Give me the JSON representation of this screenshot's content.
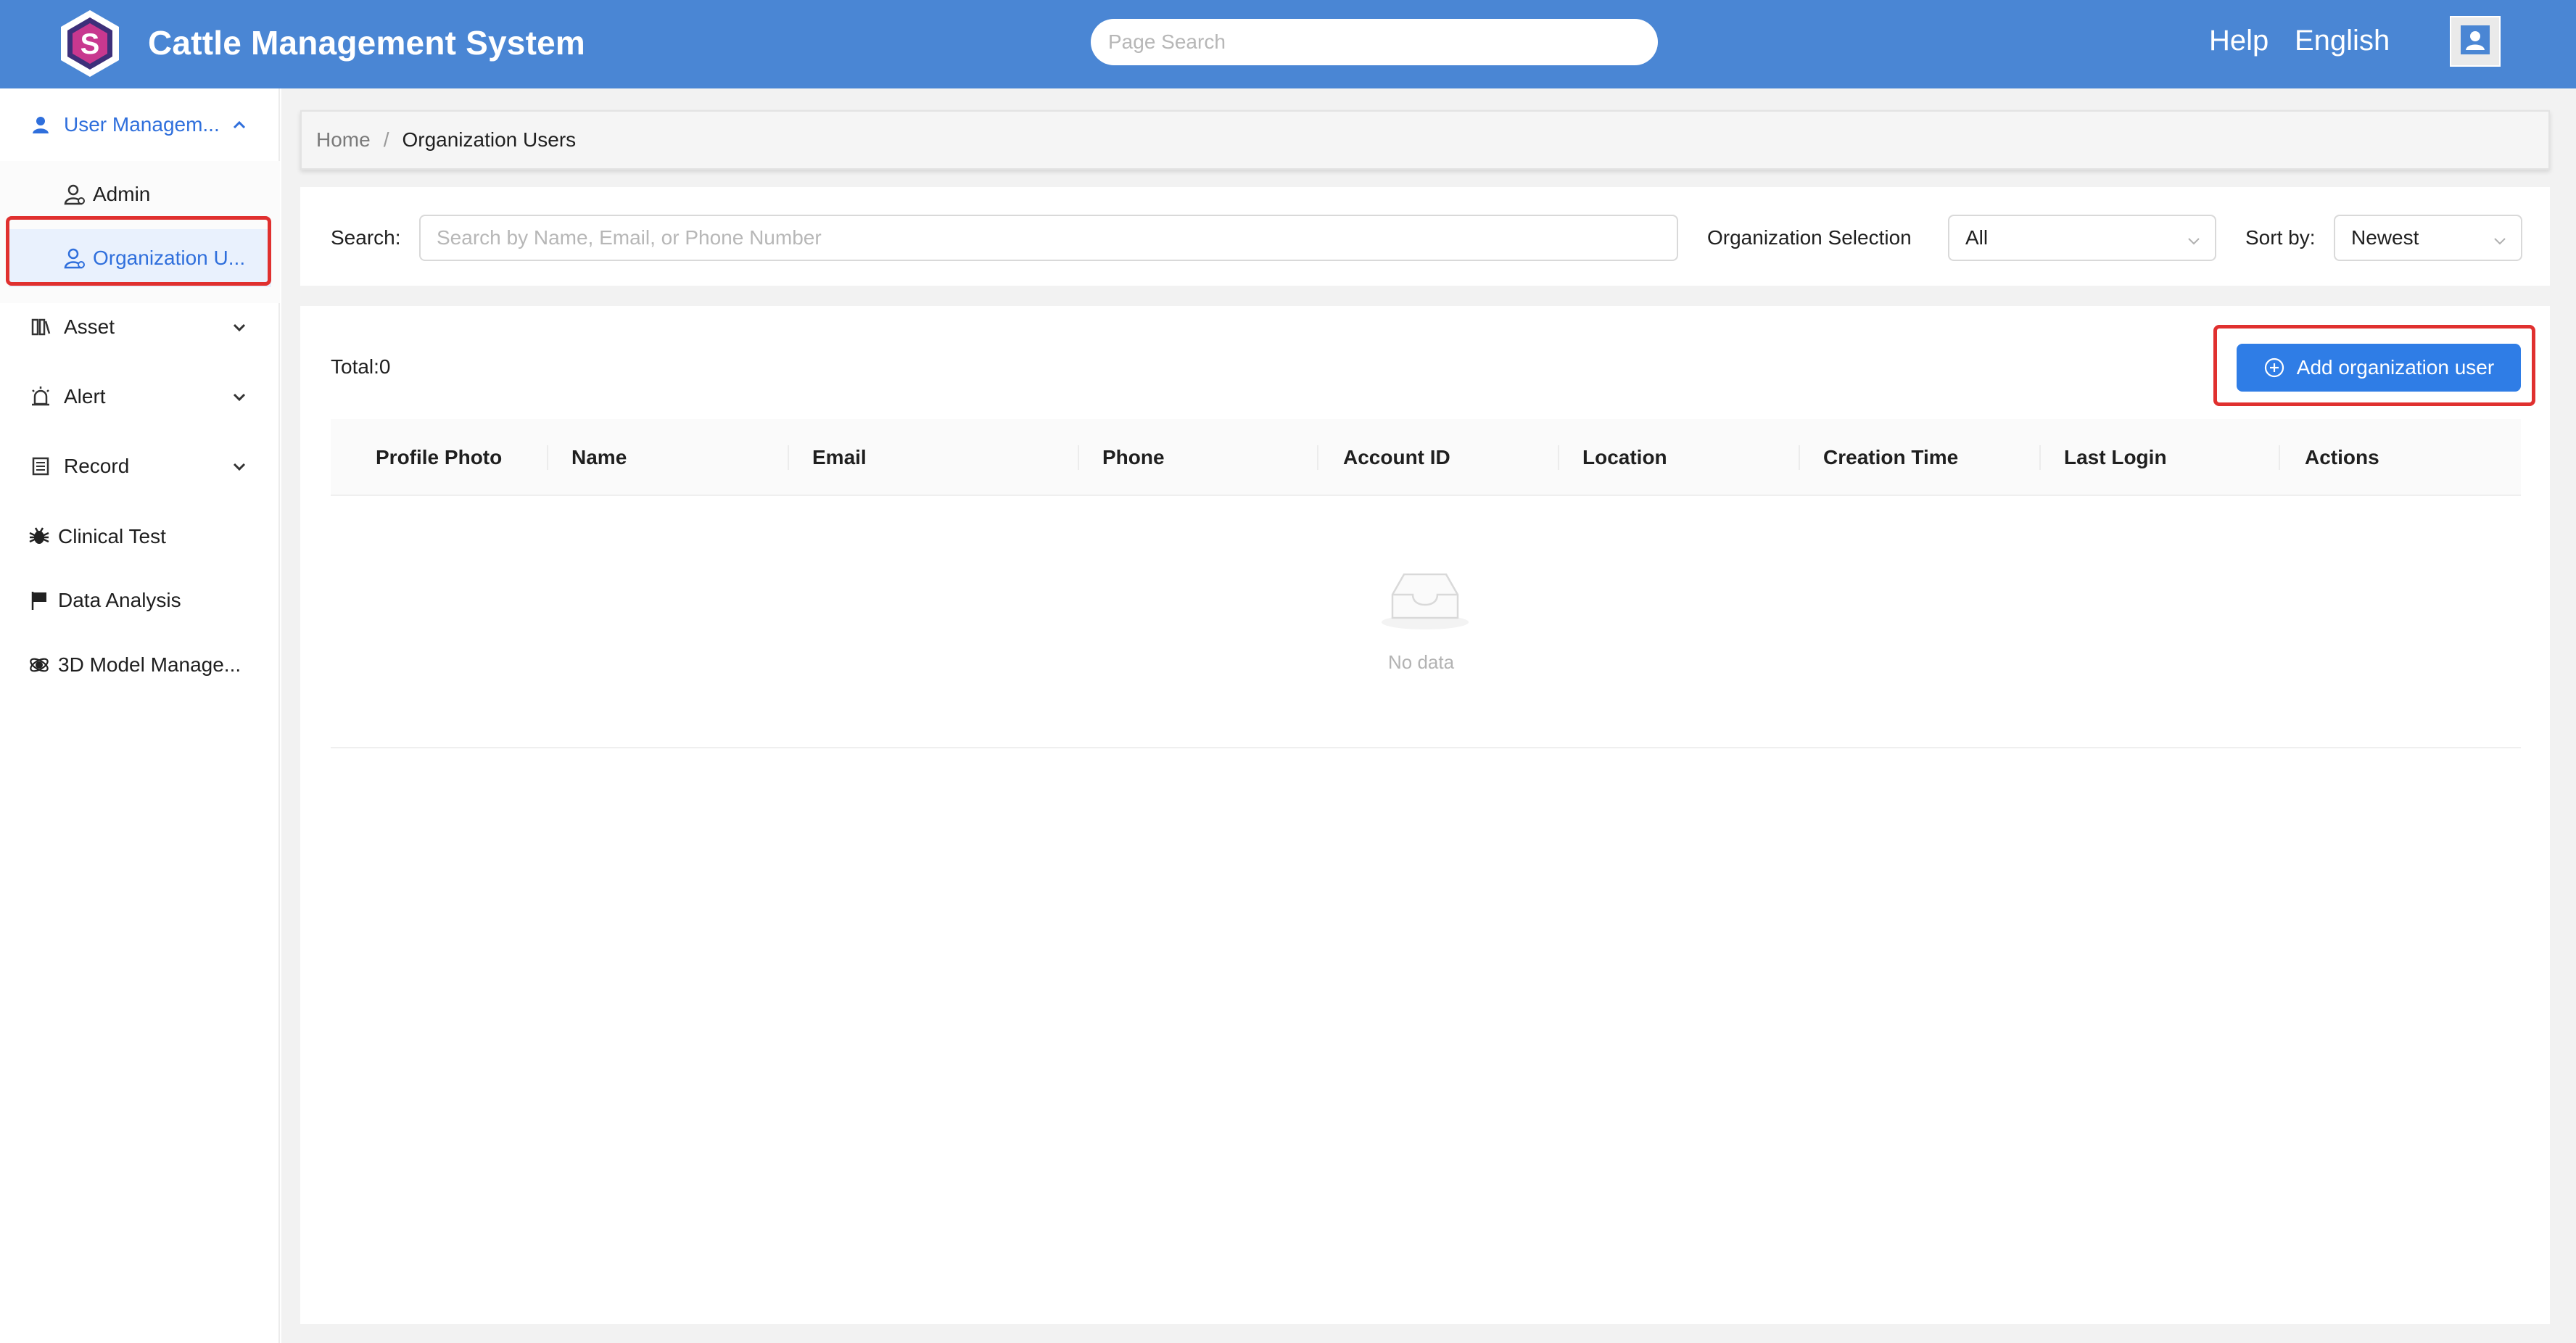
{
  "header": {
    "app_title": "Cattle Management System",
    "search_placeholder": "Page Search",
    "help_label": "Help",
    "language_label": "English",
    "brand_color": "#4a86d4"
  },
  "sidebar": {
    "user_management": {
      "label": "User Managem...",
      "icon": "user-icon",
      "expanded": true,
      "children": [
        {
          "label": "Admin",
          "icon": "user-outline-icon",
          "selected": false
        },
        {
          "label": "Organization U...",
          "icon": "user-outline-icon",
          "selected": true
        }
      ]
    },
    "items": [
      {
        "label": "Asset",
        "icon": "asset-icon",
        "has_children": true
      },
      {
        "label": "Alert",
        "icon": "alarm-icon",
        "has_children": true
      },
      {
        "label": "Record",
        "icon": "record-icon",
        "has_children": true
      },
      {
        "label": "Clinical Test",
        "icon": "bug-icon",
        "has_children": false
      },
      {
        "label": "Data Analysis",
        "icon": "flag-icon",
        "has_children": false
      },
      {
        "label": "3D Model Manage...",
        "icon": "model-icon",
        "has_children": false
      }
    ]
  },
  "breadcrumb": {
    "home": "Home",
    "separator": "/",
    "current": "Organization Users"
  },
  "filters": {
    "search_label": "Search:",
    "search_placeholder": "Search by Name, Email, or Phone Number",
    "org_label": "Organization Selection",
    "org_value": "All",
    "sort_label": "Sort by:",
    "sort_value": "Newest"
  },
  "table": {
    "total_label": "Total:0",
    "add_button_label": "Add organization user",
    "columns": [
      "Profile Photo",
      "Name",
      "Email",
      "Phone",
      "Account ID",
      "Location",
      "Creation Time",
      "Last Login",
      "Actions"
    ],
    "rows": [],
    "empty_text": "No data"
  },
  "colors": {
    "accent": "#2f7de6",
    "selected_text": "#2f6fdc",
    "selected_bg": "#e9f1fd",
    "highlight": "#e0302f"
  }
}
